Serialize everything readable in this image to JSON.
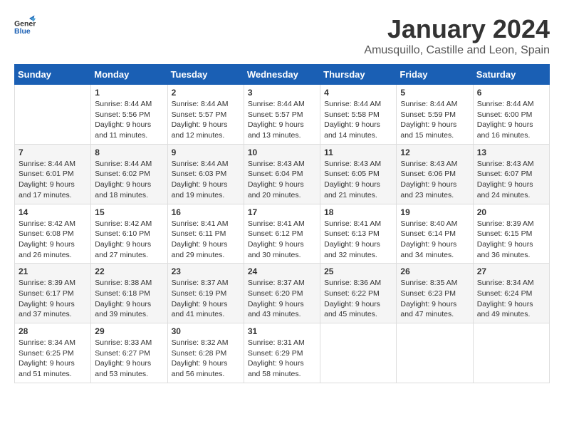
{
  "header": {
    "logo_line1": "General",
    "logo_line2": "Blue",
    "title": "January 2024",
    "subtitle": "Amusquillo, Castille and Leon, Spain"
  },
  "calendar": {
    "days_of_week": [
      "Sunday",
      "Monday",
      "Tuesday",
      "Wednesday",
      "Thursday",
      "Friday",
      "Saturday"
    ],
    "weeks": [
      [
        {
          "day": "",
          "info": ""
        },
        {
          "day": "1",
          "info": "Sunrise: 8:44 AM\nSunset: 5:56 PM\nDaylight: 9 hours\nand 11 minutes."
        },
        {
          "day": "2",
          "info": "Sunrise: 8:44 AM\nSunset: 5:57 PM\nDaylight: 9 hours\nand 12 minutes."
        },
        {
          "day": "3",
          "info": "Sunrise: 8:44 AM\nSunset: 5:57 PM\nDaylight: 9 hours\nand 13 minutes."
        },
        {
          "day": "4",
          "info": "Sunrise: 8:44 AM\nSunset: 5:58 PM\nDaylight: 9 hours\nand 14 minutes."
        },
        {
          "day": "5",
          "info": "Sunrise: 8:44 AM\nSunset: 5:59 PM\nDaylight: 9 hours\nand 15 minutes."
        },
        {
          "day": "6",
          "info": "Sunrise: 8:44 AM\nSunset: 6:00 PM\nDaylight: 9 hours\nand 16 minutes."
        }
      ],
      [
        {
          "day": "7",
          "info": "Sunrise: 8:44 AM\nSunset: 6:01 PM\nDaylight: 9 hours\nand 17 minutes."
        },
        {
          "day": "8",
          "info": "Sunrise: 8:44 AM\nSunset: 6:02 PM\nDaylight: 9 hours\nand 18 minutes."
        },
        {
          "day": "9",
          "info": "Sunrise: 8:44 AM\nSunset: 6:03 PM\nDaylight: 9 hours\nand 19 minutes."
        },
        {
          "day": "10",
          "info": "Sunrise: 8:43 AM\nSunset: 6:04 PM\nDaylight: 9 hours\nand 20 minutes."
        },
        {
          "day": "11",
          "info": "Sunrise: 8:43 AM\nSunset: 6:05 PM\nDaylight: 9 hours\nand 21 minutes."
        },
        {
          "day": "12",
          "info": "Sunrise: 8:43 AM\nSunset: 6:06 PM\nDaylight: 9 hours\nand 23 minutes."
        },
        {
          "day": "13",
          "info": "Sunrise: 8:43 AM\nSunset: 6:07 PM\nDaylight: 9 hours\nand 24 minutes."
        }
      ],
      [
        {
          "day": "14",
          "info": "Sunrise: 8:42 AM\nSunset: 6:08 PM\nDaylight: 9 hours\nand 26 minutes."
        },
        {
          "day": "15",
          "info": "Sunrise: 8:42 AM\nSunset: 6:10 PM\nDaylight: 9 hours\nand 27 minutes."
        },
        {
          "day": "16",
          "info": "Sunrise: 8:41 AM\nSunset: 6:11 PM\nDaylight: 9 hours\nand 29 minutes."
        },
        {
          "day": "17",
          "info": "Sunrise: 8:41 AM\nSunset: 6:12 PM\nDaylight: 9 hours\nand 30 minutes."
        },
        {
          "day": "18",
          "info": "Sunrise: 8:41 AM\nSunset: 6:13 PM\nDaylight: 9 hours\nand 32 minutes."
        },
        {
          "day": "19",
          "info": "Sunrise: 8:40 AM\nSunset: 6:14 PM\nDaylight: 9 hours\nand 34 minutes."
        },
        {
          "day": "20",
          "info": "Sunrise: 8:39 AM\nSunset: 6:15 PM\nDaylight: 9 hours\nand 36 minutes."
        }
      ],
      [
        {
          "day": "21",
          "info": "Sunrise: 8:39 AM\nSunset: 6:17 PM\nDaylight: 9 hours\nand 37 minutes."
        },
        {
          "day": "22",
          "info": "Sunrise: 8:38 AM\nSunset: 6:18 PM\nDaylight: 9 hours\nand 39 minutes."
        },
        {
          "day": "23",
          "info": "Sunrise: 8:37 AM\nSunset: 6:19 PM\nDaylight: 9 hours\nand 41 minutes."
        },
        {
          "day": "24",
          "info": "Sunrise: 8:37 AM\nSunset: 6:20 PM\nDaylight: 9 hours\nand 43 minutes."
        },
        {
          "day": "25",
          "info": "Sunrise: 8:36 AM\nSunset: 6:22 PM\nDaylight: 9 hours\nand 45 minutes."
        },
        {
          "day": "26",
          "info": "Sunrise: 8:35 AM\nSunset: 6:23 PM\nDaylight: 9 hours\nand 47 minutes."
        },
        {
          "day": "27",
          "info": "Sunrise: 8:34 AM\nSunset: 6:24 PM\nDaylight: 9 hours\nand 49 minutes."
        }
      ],
      [
        {
          "day": "28",
          "info": "Sunrise: 8:34 AM\nSunset: 6:25 PM\nDaylight: 9 hours\nand 51 minutes."
        },
        {
          "day": "29",
          "info": "Sunrise: 8:33 AM\nSunset: 6:27 PM\nDaylight: 9 hours\nand 53 minutes."
        },
        {
          "day": "30",
          "info": "Sunrise: 8:32 AM\nSunset: 6:28 PM\nDaylight: 9 hours\nand 56 minutes."
        },
        {
          "day": "31",
          "info": "Sunrise: 8:31 AM\nSunset: 6:29 PM\nDaylight: 9 hours\nand 58 minutes."
        },
        {
          "day": "",
          "info": ""
        },
        {
          "day": "",
          "info": ""
        },
        {
          "day": "",
          "info": ""
        }
      ]
    ]
  }
}
